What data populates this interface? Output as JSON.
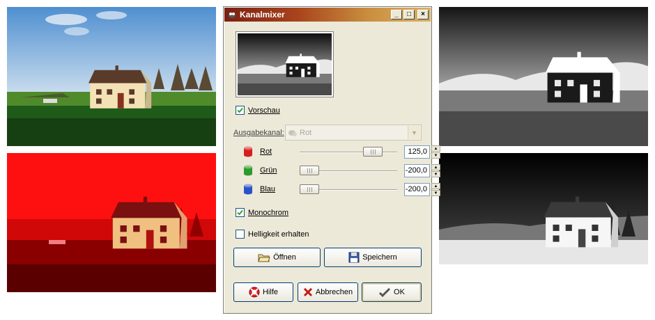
{
  "dialog": {
    "title": "Kanalmixer",
    "window_buttons": [
      "_",
      "□",
      "×"
    ],
    "preview_checkbox": {
      "label": "Vorschau",
      "checked": true
    },
    "output_channel": {
      "label": "Ausgabekanal:",
      "value": "Rot",
      "enabled": false
    },
    "channels": [
      {
        "label": "Rot",
        "value": "125,0",
        "level": 125,
        "color": "#d42020"
      },
      {
        "label": "Grün",
        "value": "-200,0",
        "level": -200,
        "color": "#2c9a2c"
      },
      {
        "label": "Blau",
        "value": "-200,0",
        "level": -200,
        "color": "#2a52c8"
      }
    ],
    "slider_range": [
      -200,
      200
    ],
    "monochrome_checkbox": {
      "label": "Monochrom",
      "checked": true
    },
    "preserve_checkbox": {
      "label": "Helligkeit erhalten",
      "checked": false
    },
    "buttons": {
      "open": "Öffnen",
      "save": "Speichern",
      "help": "Hilfe",
      "cancel": "Abbrechen",
      "ok": "OK"
    },
    "icons": {
      "app": "gimp-icon",
      "open": "folder-icon",
      "save": "floppy-disk-icon",
      "help": "lifebuoy-icon",
      "cancel": "x-cross-icon",
      "ok": "check-icon"
    }
  },
  "photos": [
    {
      "name": "original-color-photo",
      "description_colors": "sky blue, green meadow, cream house"
    },
    {
      "name": "red-channel-photo",
      "description_colors": "red tinted"
    },
    {
      "name": "monochrome-mix-photo-1",
      "description_colors": "grayscale infrared look"
    },
    {
      "name": "monochrome-mix-photo-2",
      "description_colors": "grayscale high contrast"
    }
  ]
}
